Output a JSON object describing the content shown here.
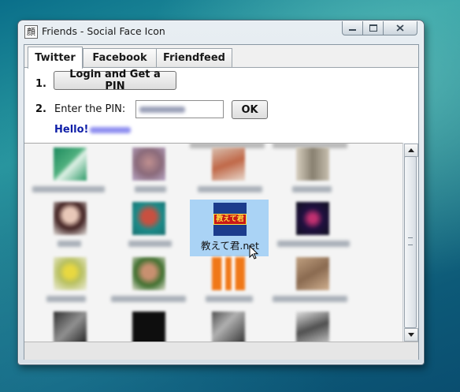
{
  "window": {
    "title": "Friends - Social Face Icon",
    "app_icon": "顔"
  },
  "tabs": [
    {
      "label": "Twitter",
      "active": true
    },
    {
      "label": "Facebook",
      "active": false
    },
    {
      "label": "Friendfeed",
      "active": false
    }
  ],
  "auth": {
    "step1_number": "1.",
    "login_button": "Login and Get a PIN",
    "step2_number": "2.",
    "pin_label": "Enter the PIN:",
    "ok_button": "OK",
    "hello_label": "Hello!"
  },
  "friends": {
    "selected_name": "教えて君.net",
    "selected_logo_text": "教えて君"
  },
  "colors": {
    "hello": "#1020a8",
    "selection": "#aad3f5"
  }
}
